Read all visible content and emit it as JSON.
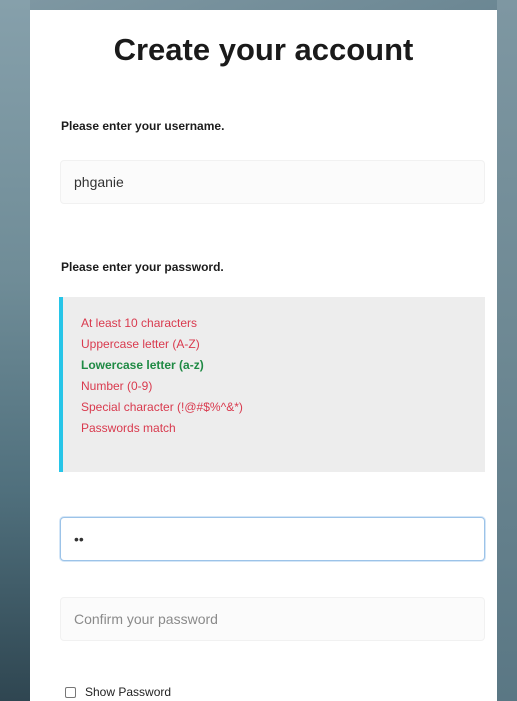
{
  "form": {
    "title": "Create your account",
    "username_label": "Please enter your username.",
    "username_value": "phganie",
    "password_label": "Please enter your password.",
    "password_value": "••",
    "confirm_placeholder": "Confirm your password",
    "show_password_label": "Show Password",
    "show_password_checked": false
  },
  "requirements": [
    {
      "text": "At least 10 characters",
      "met": false
    },
    {
      "text": "Uppercase letter (A-Z)",
      "met": false
    },
    {
      "text": "Lowercase letter (a-z)",
      "met": true
    },
    {
      "text": "Number (0-9)",
      "met": false
    },
    {
      "text": "Special character (!@#$%^&*)",
      "met": false
    },
    {
      "text": "Passwords match",
      "met": false
    }
  ],
  "colors": {
    "unmet": "#d93a4e",
    "met": "#1f8a44",
    "accent_bar": "#27c5e8"
  }
}
